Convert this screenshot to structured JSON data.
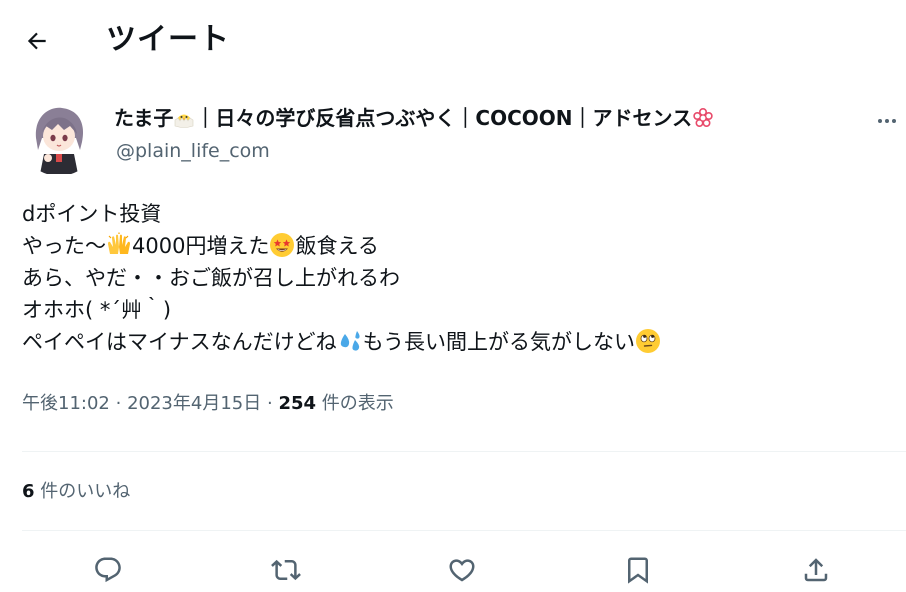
{
  "header": {
    "back_icon": "arrow-left-icon",
    "title": "ツイート"
  },
  "author": {
    "name_prefix": "たま子",
    "name_suffix": "｜日々の学び反省点つぶやく｜COCOON｜アドセンス",
    "handle": "@plain_life_com",
    "emoji_1": "hatching-chick-icon",
    "emoji_2": "flower-badge-icon"
  },
  "tweet": {
    "line1": "dポイント投資",
    "line2_a": "やった〜",
    "line2_b": "4000円増えた",
    "line2_c": "飯食える",
    "line3": "あら、やだ・・おご飯が召し上がれるわ",
    "line4": "オホホ( *´艸｀)",
    "line5_a": "ペイペイはマイナスなんだけどね",
    "line5_b": "もう長い間上がる気がしない",
    "emojis": [
      "raised-hands-icon",
      "star-struck-icon",
      "sweat-drops-icon",
      "rolling-eyes-icon"
    ]
  },
  "meta": {
    "time": "午後11:02",
    "separator": "·",
    "date": "2023年4月15日",
    "views_count": "254",
    "views_label": "件の表示"
  },
  "likes": {
    "count": "6",
    "label": "件のいいね"
  },
  "colors": {
    "text": "#0f1419",
    "secondary": "#536471",
    "divider": "#eff3f4",
    "icon": "#536471"
  },
  "actions": [
    "reply-icon",
    "retweet-icon",
    "like-icon",
    "bookmark-icon",
    "share-icon"
  ]
}
